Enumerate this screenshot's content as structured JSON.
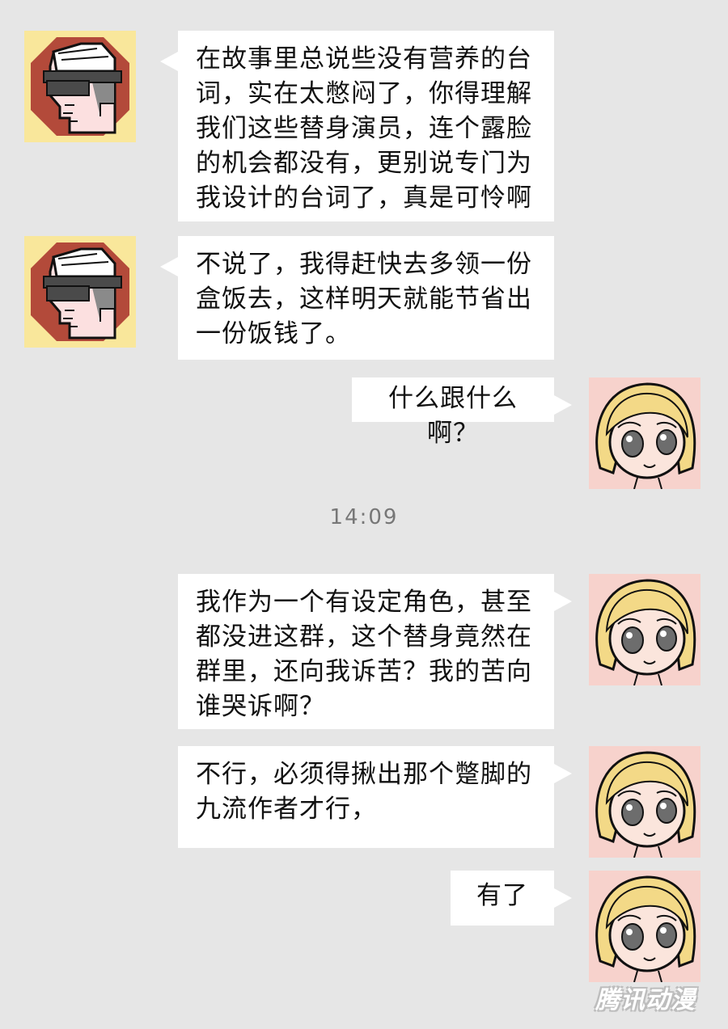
{
  "messages": [
    {
      "side": "left",
      "text": "在故事里总说些没有营养的台\n词，实在太憋闷了，你得理解\n我们这些替身演员，连个露脸\n的机会都没有，更别说专门为\n我设计的台词了，真是可怜啊"
    },
    {
      "side": "left",
      "text": "不说了，我得赶快去多领一份\n盒饭去，这样明天就能节省出\n一份饭钱了。"
    },
    {
      "side": "right",
      "text": "什么跟什么啊？"
    },
    {
      "side": "right",
      "text": "我作为一个有设定角色，甚至\n都没进这群，这个替身竟然在\n群里，还向我诉苦？我的苦向\n谁哭诉啊？"
    },
    {
      "side": "right",
      "text": "不行，必须得揪出那个蹩脚的\n九流作者才行，"
    },
    {
      "side": "right",
      "text": "有了"
    }
  ],
  "timestamp": "14:09",
  "watermark": "腾讯动漫",
  "colors": {
    "background": "#e6e6e6",
    "bubble": "#ffffff",
    "avatar_left_bg": "#f9e79b",
    "avatar_right_bg": "#f7d2cc",
    "hair": "#f3d987"
  }
}
